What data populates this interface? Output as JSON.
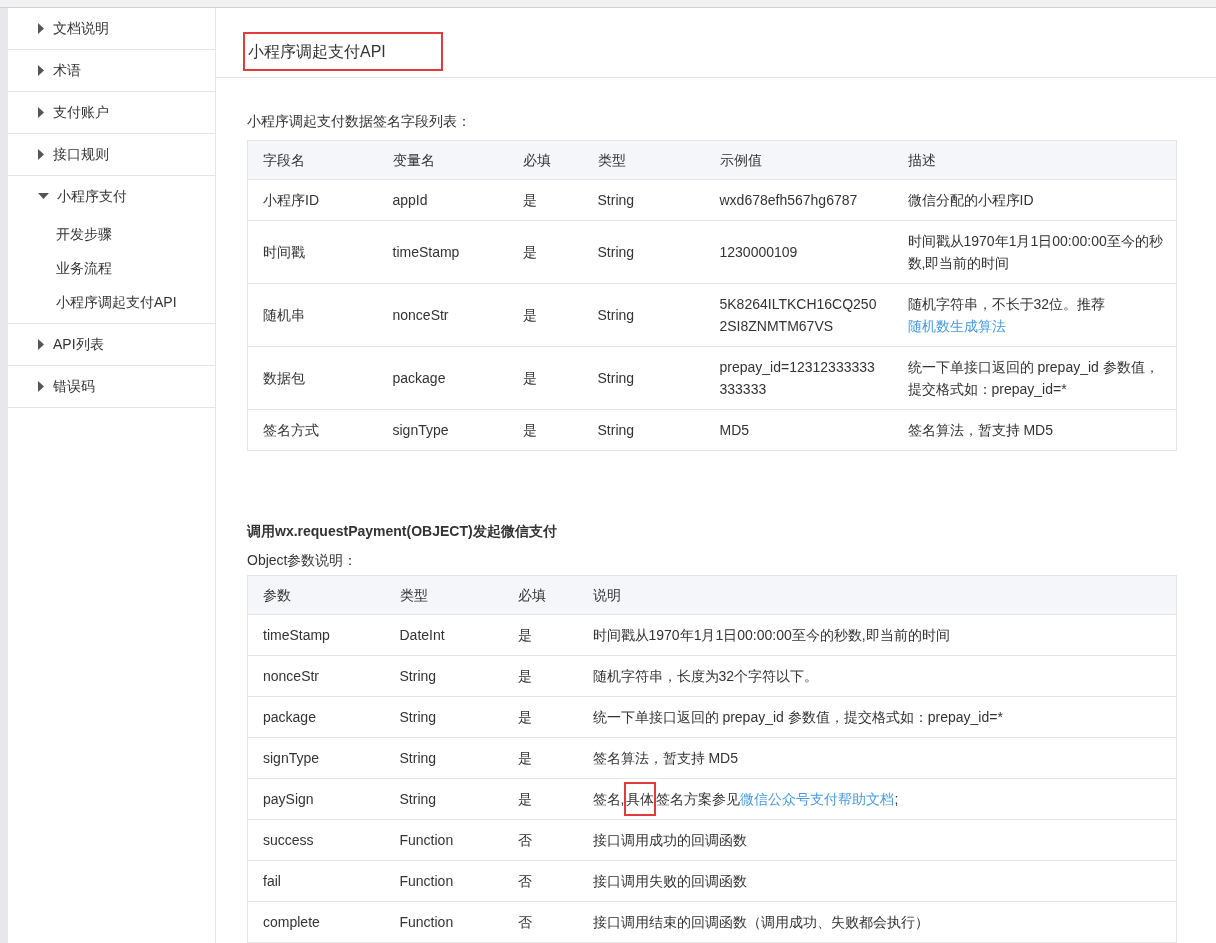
{
  "sidebar": {
    "items": [
      {
        "label": "文档说明",
        "expanded": false
      },
      {
        "label": "术语",
        "expanded": false
      },
      {
        "label": "支付账户",
        "expanded": false
      },
      {
        "label": "接口规则",
        "expanded": false
      },
      {
        "label": "小程序支付",
        "expanded": true,
        "children": [
          {
            "label": "开发步骤"
          },
          {
            "label": "业务流程"
          },
          {
            "label": "小程序调起支付API"
          }
        ]
      },
      {
        "label": "API列表",
        "expanded": false
      },
      {
        "label": "错误码",
        "expanded": false
      }
    ]
  },
  "page_title": {
    "text": "小程序调起支付API",
    "highlighted": true
  },
  "sign_section": {
    "caption": "小程序调起支付数据签名字段列表：",
    "table": {
      "columns": [
        "字段名",
        "变量名",
        "必填",
        "类型",
        "示例值",
        "描述"
      ],
      "rows": [
        [
          [
            {
              "text": "小程序ID"
            }
          ],
          [
            {
              "text": "appId"
            }
          ],
          [
            {
              "text": "是"
            }
          ],
          [
            {
              "text": "String"
            }
          ],
          [
            {
              "text": "wxd678efh567hg6787"
            }
          ],
          [
            {
              "text": "微信分配的小程序ID"
            }
          ]
        ],
        [
          [
            {
              "text": "时间戳"
            }
          ],
          [
            {
              "text": "timeStamp"
            }
          ],
          [
            {
              "text": "是"
            }
          ],
          [
            {
              "text": "String"
            }
          ],
          [
            {
              "text": "1230000109"
            }
          ],
          [
            {
              "text": "时间戳从1970年1月1日00:00:00至今的秒数,即当前的时间"
            }
          ]
        ],
        [
          [
            {
              "text": "随机串"
            }
          ],
          [
            {
              "text": "nonceStr"
            }
          ],
          [
            {
              "text": "是"
            }
          ],
          [
            {
              "text": "String"
            }
          ],
          [
            {
              "text": "5K8264ILTKCH16CQ2502SI8ZNMTM67VS"
            }
          ],
          [
            {
              "text": "随机字符串，不长于32位。推荐"
            },
            {
              "text": "随机数生成算法",
              "link": true
            }
          ]
        ],
        [
          [
            {
              "text": "数据包"
            }
          ],
          [
            {
              "text": "package"
            }
          ],
          [
            {
              "text": "是"
            }
          ],
          [
            {
              "text": "String"
            }
          ],
          [
            {
              "text": "prepay_id=12312333333333333"
            }
          ],
          [
            {
              "text": "统一下单接口返回的 prepay_id 参数值，提交格式如：prepay_id=*"
            }
          ]
        ],
        [
          [
            {
              "text": "签名方式"
            }
          ],
          [
            {
              "text": "signType"
            }
          ],
          [
            {
              "text": "是"
            }
          ],
          [
            {
              "text": "String"
            }
          ],
          [
            {
              "text": "MD5"
            }
          ],
          [
            {
              "text": "签名算法，暂支持 MD5"
            }
          ]
        ]
      ]
    }
  },
  "request_section": {
    "heading": "调用wx.requestPayment(OBJECT)发起微信支付",
    "caption": "Object参数说明：",
    "table": {
      "columns": [
        "参数",
        "类型",
        "必填",
        "说明"
      ],
      "rows": [
        [
          [
            {
              "text": "timeStamp"
            }
          ],
          [
            {
              "text": "DateInt"
            }
          ],
          [
            {
              "text": "是"
            }
          ],
          [
            {
              "text": "时间戳从1970年1月1日00:00:00至今的秒数,即当前的时间"
            }
          ]
        ],
        [
          [
            {
              "text": "nonceStr"
            }
          ],
          [
            {
              "text": "String"
            }
          ],
          [
            {
              "text": "是"
            }
          ],
          [
            {
              "text": "随机字符串，长度为32个字符以下。"
            }
          ]
        ],
        [
          [
            {
              "text": "package"
            }
          ],
          [
            {
              "text": "String"
            }
          ],
          [
            {
              "text": "是"
            }
          ],
          [
            {
              "text": "统一下单接口返回的 prepay_id 参数值，提交格式如：prepay_id=*"
            }
          ]
        ],
        [
          [
            {
              "text": "signType"
            }
          ],
          [
            {
              "text": "String"
            }
          ],
          [
            {
              "text": "是"
            }
          ],
          [
            {
              "text": "签名算法，暂支持 MD5"
            }
          ]
        ],
        [
          [
            {
              "text": "paySign"
            }
          ],
          [
            {
              "text": "String"
            }
          ],
          [
            {
              "text": "是"
            }
          ],
          [
            {
              "text": "签名,"
            },
            {
              "text": "具体",
              "highlighted": true
            },
            {
              "text": "签名方案参见"
            },
            {
              "text": "微信公众号支付帮助文档",
              "link": true
            },
            {
              "text": ";"
            }
          ]
        ],
        [
          [
            {
              "text": "success"
            }
          ],
          [
            {
              "text": "Function"
            }
          ],
          [
            {
              "text": "否"
            }
          ],
          [
            {
              "text": "接口调用成功的回调函数"
            }
          ]
        ],
        [
          [
            {
              "text": "fail"
            }
          ],
          [
            {
              "text": "Function"
            }
          ],
          [
            {
              "text": "否"
            }
          ],
          [
            {
              "text": "接口调用失败的回调函数"
            }
          ]
        ],
        [
          [
            {
              "text": "complete"
            }
          ],
          [
            {
              "text": "Function"
            }
          ],
          [
            {
              "text": "否"
            }
          ],
          [
            {
              "text": "接口调用结束的回调函数（调用成功、失败都会执行）"
            }
          ]
        ]
      ]
    }
  }
}
